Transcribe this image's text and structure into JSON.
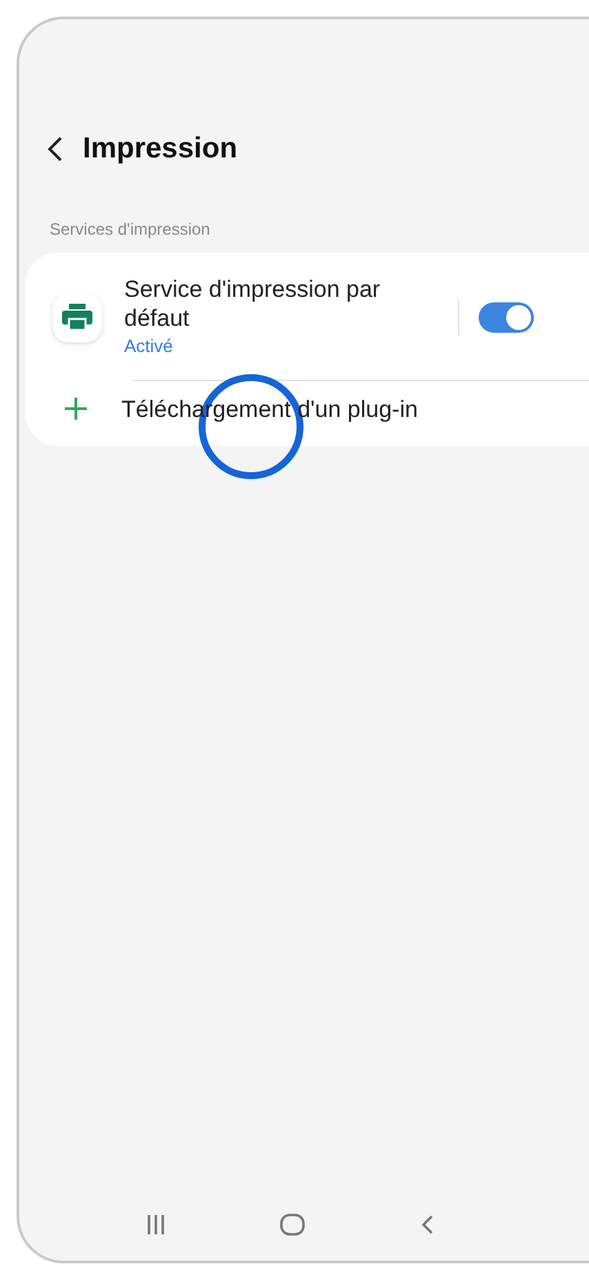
{
  "header": {
    "title": "Impression"
  },
  "section": {
    "label": "Services d'impression"
  },
  "items": [
    {
      "kind": "service",
      "title": "Service d'impression par défaut",
      "status": "Activé",
      "on": true
    },
    {
      "kind": "add",
      "title": "Téléchargement d'un plug-in",
      "tap_marker": true
    }
  ]
}
